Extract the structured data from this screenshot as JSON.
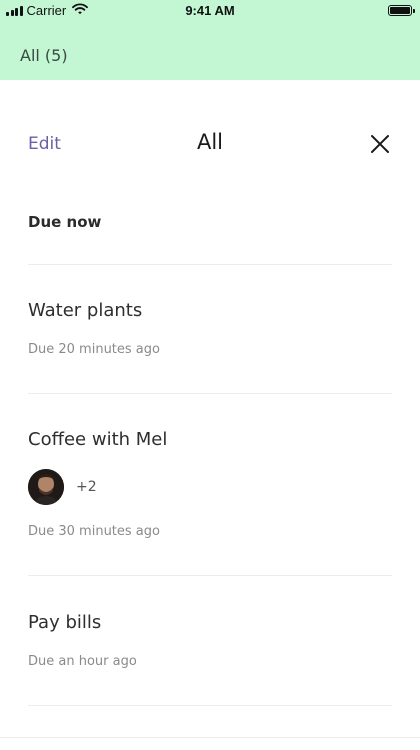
{
  "status_bar": {
    "carrier": "Carrier",
    "time": "9:41 AM",
    "signal_icon": "signal-icon",
    "wifi_icon": "wifi-icon",
    "battery_icon": "battery-icon",
    "battery_level": 1.0
  },
  "top_strip": {
    "label": "All (5)",
    "background": "#c3f7d4"
  },
  "header": {
    "edit_label": "Edit",
    "title": "All",
    "close_icon": "close-icon",
    "accent_color": "#6b5fa6"
  },
  "section": {
    "title": "Due now"
  },
  "tasks": [
    {
      "title": "Water plants",
      "due": "Due 20 minutes ago"
    },
    {
      "title": "Coffee with Mel",
      "attendees_more": "+2",
      "avatar_icon": "avatar",
      "due": "Due 30 minutes ago"
    },
    {
      "title": "Pay bills",
      "due": "Due an hour ago"
    }
  ]
}
